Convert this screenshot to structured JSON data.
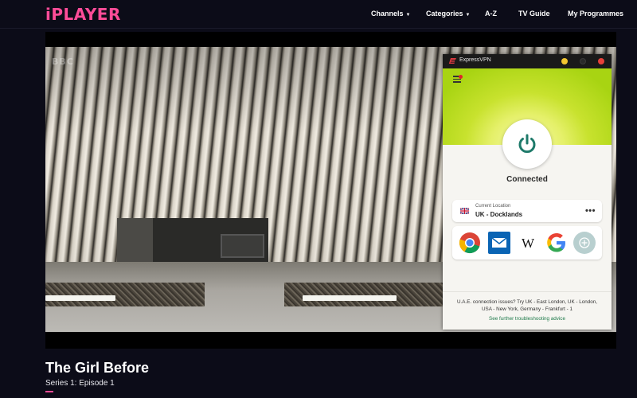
{
  "header": {
    "logo": "iPLAYER",
    "nav": [
      {
        "label": "Channels",
        "dropdown": true
      },
      {
        "label": "Categories",
        "dropdown": true
      },
      {
        "label": "A-Z",
        "dropdown": false
      },
      {
        "label": "TV Guide",
        "dropdown": false
      },
      {
        "label": "My Programmes",
        "dropdown": false
      }
    ]
  },
  "player": {
    "watermark": "BBC"
  },
  "vpn": {
    "title": "ExpressVPN",
    "status": "Connected",
    "location_label": "Current Location",
    "location_name": "UK - Docklands",
    "more_icon": "•••",
    "shortcuts": [
      "chrome-icon",
      "mail-icon",
      "wikipedia-icon",
      "google-icon",
      "add-shortcut-icon"
    ],
    "note": "U.A.E. connection issues? Try UK - East London, UK - London, USA - New York, Germany - Frankfurt - 1",
    "link": "See further troubleshooting advice",
    "colors": {
      "accent": "#1e7a4a",
      "brand_red": "#da3940",
      "hero": "#c8e22e"
    }
  },
  "programme": {
    "title": "The Girl Before",
    "subtitle": "Series 1: Episode 1"
  },
  "colors": {
    "brand": "#ff4c98",
    "background": "#0c0c18"
  }
}
